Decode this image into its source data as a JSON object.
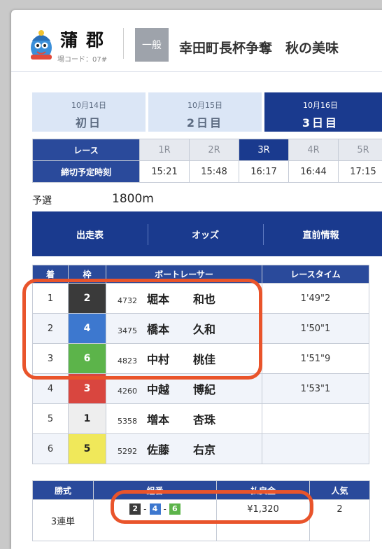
{
  "header": {
    "venue": "蒲郡",
    "venue_code": "場コード：07#",
    "grade": "一般",
    "title": "幸田町長杯争奪　秋の美味"
  },
  "days": [
    {
      "date": "10月14日",
      "label": "初日",
      "active": false
    },
    {
      "date": "10月15日",
      "label": "2日目",
      "active": false
    },
    {
      "date": "10月16日",
      "label": "3日目",
      "active": true
    }
  ],
  "race_table": {
    "race_label": "レース",
    "time_label": "締切予定時刻",
    "races": [
      "1R",
      "2R",
      "3R",
      "4R",
      "5R"
    ],
    "active_race": "3R",
    "times": [
      "15:21",
      "15:48",
      "16:17",
      "16:44",
      "17:15"
    ]
  },
  "race_info": {
    "type": "予選",
    "distance": "1800m"
  },
  "nav": {
    "entry": "出走表",
    "odds": "オッズ",
    "pre_info": "直前情報"
  },
  "results": {
    "headers": [
      "着",
      "枠",
      "ボートレーサー",
      "レースタイム"
    ],
    "rows": [
      {
        "place": "1",
        "lane": "2",
        "lane_color": "#3a3a3a",
        "reg": "4732",
        "family": "堀本",
        "given": "和也",
        "time": "1'49\"2"
      },
      {
        "place": "2",
        "lane": "4",
        "lane_color": "#3d78cf",
        "reg": "3475",
        "family": "橋本",
        "given": "久和",
        "time": "1'50\"1"
      },
      {
        "place": "3",
        "lane": "6",
        "lane_color": "#5cb44a",
        "reg": "4823",
        "family": "中村",
        "given": "桃佳",
        "time": "1'51\"9"
      },
      {
        "place": "4",
        "lane": "3",
        "lane_color": "#d9463f",
        "reg": "4260",
        "family": "中越",
        "given": "博紀",
        "time": "1'53\"1"
      },
      {
        "place": "5",
        "lane": "1",
        "lane_color": "#eeeeee",
        "reg": "5358",
        "family": "増本",
        "given": "杏珠",
        "time": ""
      },
      {
        "place": "6",
        "lane": "5",
        "lane_color": "#f0e85a",
        "reg": "5292",
        "family": "佐藤",
        "given": "右京",
        "time": ""
      }
    ]
  },
  "payout": {
    "headers": [
      "勝式",
      "組番",
      "払戻金",
      "人気"
    ],
    "bet_type": "3連単",
    "combo": [
      {
        "num": "2",
        "color": "#3a3a3a"
      },
      {
        "num": "4",
        "color": "#3d78cf"
      },
      {
        "num": "6",
        "color": "#5cb44a"
      }
    ],
    "combo_sep": "-",
    "amount": "¥1,320",
    "popularity": "2"
  },
  "colors": {
    "primary": "#1a3a8e",
    "header_blue": "#2a4a9b",
    "highlight": "#e9542b"
  }
}
